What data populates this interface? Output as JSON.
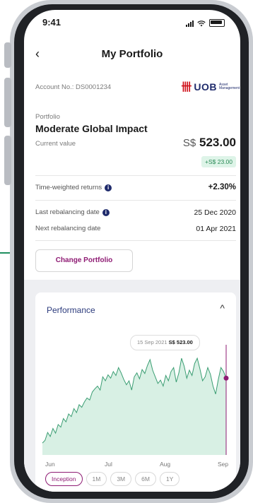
{
  "status_bar": {
    "time": "9:41"
  },
  "nav": {
    "back_icon": "‹",
    "title": "My Portfolio"
  },
  "account": {
    "label": "Account No.: DS0001234"
  },
  "logo": {
    "mark": "卌",
    "text": "UOB",
    "sub": "Asset Management"
  },
  "portfolio": {
    "label": "Portfolio",
    "name": "Moderate Global Impact"
  },
  "current_value": {
    "label": "Current value",
    "currency": "S$",
    "amount": "523.00",
    "change": "+S$ 23.00"
  },
  "metrics": {
    "twr_label": "Time-weighted returns",
    "twr_value": "+2.30%",
    "last_rebal_label": "Last rebalancing date",
    "last_rebal_value": "25 Dec 2020",
    "next_rebal_label": "Next rebalancing date",
    "next_rebal_value": "01 Apr 2021",
    "info_icon": "i"
  },
  "change_button": {
    "label": "Change Portfolio"
  },
  "performance": {
    "title": "Performance",
    "chevron": "^",
    "tooltip_date": "15 Sep 2021",
    "tooltip_value": "S$ 523.00",
    "range_tabs": [
      "Inception",
      "1M",
      "3M",
      "6M",
      "1Y"
    ],
    "active_range": "Inception"
  },
  "colors": {
    "accent": "#8e1b73",
    "line": "#3a9d72",
    "fill": "#d8f0e4",
    "brand_navy": "#1f2b6c",
    "brand_red": "#d0121b"
  },
  "chart_data": {
    "type": "area",
    "x_ticks": [
      "Jun",
      "Jul",
      "Aug",
      "Sep"
    ],
    "values": [
      18,
      22,
      34,
      28,
      40,
      33,
      46,
      42,
      55,
      50,
      62,
      58,
      70,
      64,
      76,
      72,
      80,
      86,
      83,
      95,
      100,
      104,
      98,
      118,
      112,
      121,
      116,
      126,
      120,
      132,
      124,
      114,
      106,
      112,
      98,
      118,
      124,
      115,
      129,
      123,
      135,
      144,
      128,
      118,
      108,
      113,
      104,
      120,
      112,
      126,
      132,
      110,
      124,
      146,
      134,
      116,
      128,
      120,
      138,
      146,
      130,
      112,
      118,
      132,
      122,
      104,
      92,
      114,
      132,
      126,
      116
    ],
    "ylim": [
      0,
      160
    ],
    "highlight_index": 70
  }
}
